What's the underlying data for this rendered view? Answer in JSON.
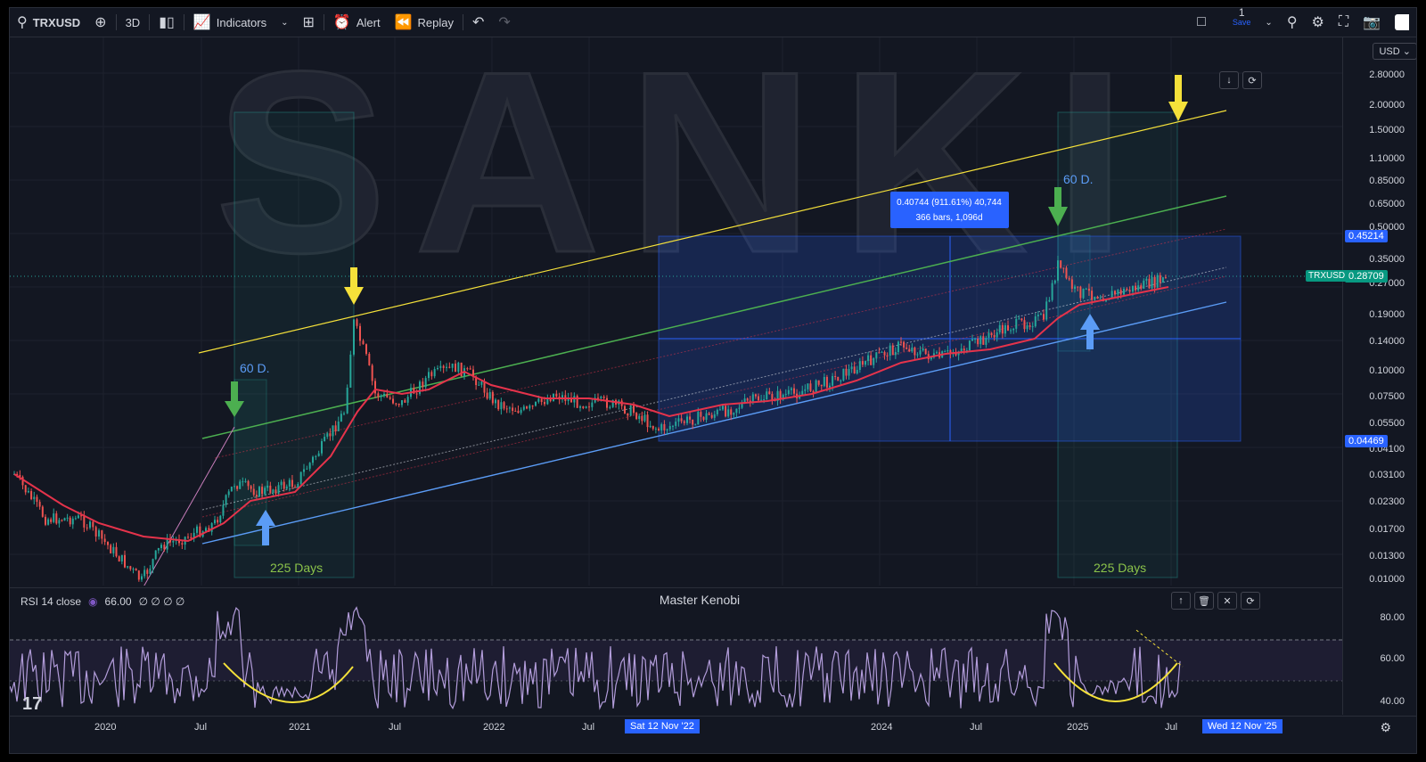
{
  "toolbar": {
    "symbol": "TRXUSD",
    "interval": "3D",
    "indicators": "Indicators",
    "alert": "Alert",
    "replay": "Replay",
    "layout_num": "1",
    "save": "Save",
    "currency": "USD"
  },
  "chart": {
    "price_labels": [
      "2.80000",
      "2.00000",
      "1.50000",
      "1.10000",
      "0.85000",
      "0.65000",
      "0.50000",
      "0.35000",
      "0.27000",
      "0.19000",
      "0.14000",
      "0.10000",
      "0.07500",
      "0.05500",
      "0.04100",
      "0.03100",
      "0.02300",
      "0.01700",
      "0.01300",
      "0.01000"
    ],
    "tag_high": "0.45214",
    "tag_current_sym": "TRXUSD",
    "tag_current": "0.28709",
    "tag_low": "0.04469",
    "measure_line1": "0.40744 (911.61%) 40,744",
    "measure_line2": "366 bars, 1,096d",
    "label_60d": "60 D.",
    "label_225": "225 Days",
    "watermark": "SANKI",
    "title": "Master Kenobi"
  },
  "rsi": {
    "name": "RSI 14 close",
    "value": "66.00",
    "extra": "∅ ∅ ∅ ∅",
    "labels": [
      "80.00",
      "60.00",
      "40.00"
    ]
  },
  "time_axis": {
    "labels": [
      "2020",
      "Jul",
      "2021",
      "Jul",
      "2022",
      "Jul",
      "Jul",
      "2024",
      "Jul",
      "2025",
      "Jul"
    ],
    "cursor_left": "Sat 12 Nov '22",
    "cursor_right": "Wed 12 Nov '25"
  },
  "colors": {
    "bg": "#131722",
    "up": "#26a69a",
    "down": "#ef5350",
    "ma": "#e5334b",
    "yellow": "#f5e13a",
    "green": "#4caf50",
    "blue": "#5b9cf6",
    "rsi": "#b39ddb"
  }
}
